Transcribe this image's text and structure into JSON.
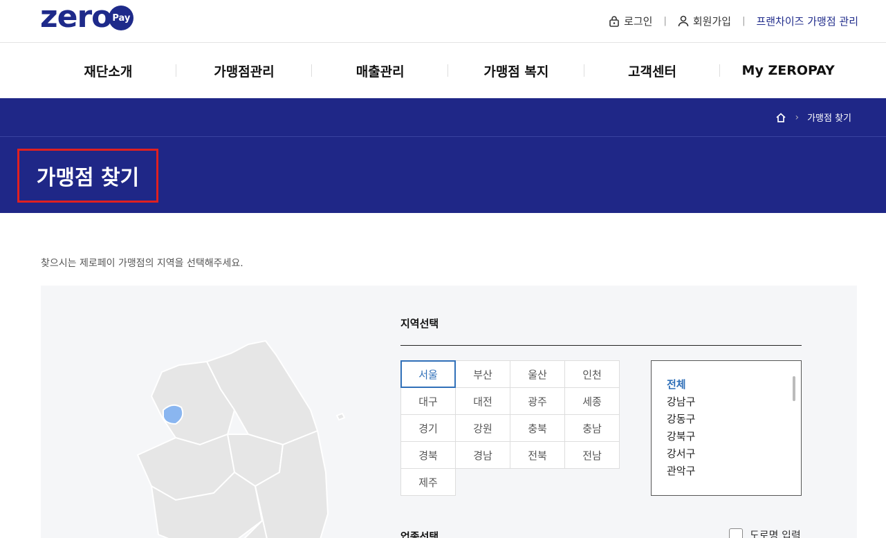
{
  "header": {
    "logo_text": "zero",
    "logo_badge": "Pay",
    "util": {
      "login": "로그인",
      "signup": "회원가입",
      "franchise": "프랜차이즈 가맹점 관리"
    }
  },
  "gnb": [
    "재단소개",
    "가맹점관리",
    "매출관리",
    "가맹점 복지",
    "고객센터",
    "My ZEROPAY"
  ],
  "banner": {
    "breadcrumb_current": "가맹점 찾기",
    "title": "가맹점 찾기"
  },
  "content": {
    "guide": "찾으시는 제로페이 가맹점의 지역을 선택해주세요.",
    "region_label": "지역선택",
    "regions": [
      [
        "서울",
        "부산",
        "울산",
        "인천"
      ],
      [
        "대구",
        "대전",
        "광주",
        "세종"
      ],
      [
        "경기",
        "강원",
        "충북",
        "충남"
      ],
      [
        "경북",
        "경남",
        "전북",
        "전남"
      ],
      [
        "제주"
      ]
    ],
    "selected_region": "서울",
    "districts": [
      "전체",
      "강남구",
      "강동구",
      "강북구",
      "강서구",
      "관악구"
    ],
    "selected_district": "전체",
    "biz_label": "업종선택",
    "road_input_label": "도로명 입력"
  },
  "colors": {
    "brand": "#1e2a8a",
    "banner": "#1f2787",
    "accent": "#2f6fb8",
    "highlight_border": "#e02020"
  }
}
